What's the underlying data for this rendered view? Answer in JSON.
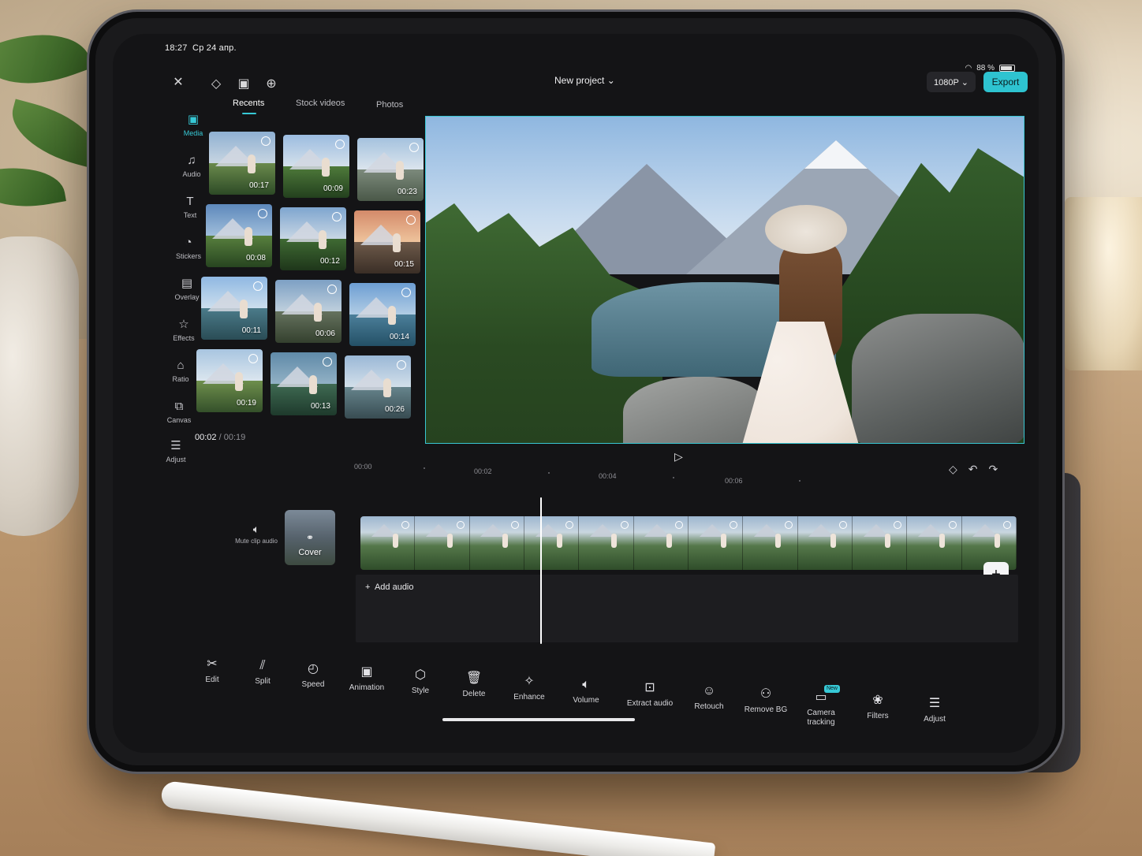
{
  "status": {
    "time": "18:27",
    "date": "Ср 24 апр.",
    "battery": "88 %"
  },
  "header": {
    "project_title": "New project ⌄",
    "resolution": "1080P ⌄",
    "export_label": "Export"
  },
  "sidebar": {
    "items": [
      {
        "label": "Media",
        "icon": "media-icon"
      },
      {
        "label": "Audio",
        "icon": "music-note-icon"
      },
      {
        "label": "Text",
        "icon": "text-icon"
      },
      {
        "label": "Stickers",
        "icon": "sticker-icon"
      },
      {
        "label": "Overlay",
        "icon": "overlay-icon"
      },
      {
        "label": "Effects",
        "icon": "effects-icon"
      },
      {
        "label": "Ratio",
        "icon": "ratio-icon"
      },
      {
        "label": "Canvas",
        "icon": "canvas-icon"
      },
      {
        "label": "Adjust",
        "icon": "adjust-icon"
      }
    ]
  },
  "media_tabs": [
    "Recents",
    "Stock videos",
    "Photos"
  ],
  "media_grid": [
    "00:17",
    "00:09",
    "00:23",
    "00:08",
    "00:12",
    "00:15",
    "00:11",
    "00:06",
    "00:14",
    "00:19",
    "00:13",
    "00:26"
  ],
  "timecode": {
    "current": "00:02",
    "total": "/ 00:19"
  },
  "ruler": [
    "00:00",
    "00:02",
    "00:04",
    "00:06"
  ],
  "timeline": {
    "mute_label": "Mute clip audio",
    "cover_label": "Cover",
    "add_audio_label": "Add audio"
  },
  "toolbar": [
    {
      "label": "Edit",
      "icon": "scissors-icon"
    },
    {
      "label": "Split",
      "icon": "split-icon"
    },
    {
      "label": "Speed",
      "icon": "speed-icon"
    },
    {
      "label": "Animation",
      "icon": "animation-icon"
    },
    {
      "label": "Style",
      "icon": "style-icon"
    },
    {
      "label": "Delete",
      "icon": "trash-icon"
    },
    {
      "label": "Enhance",
      "icon": "enhance-icon"
    },
    {
      "label": "Volume",
      "icon": "volume-icon"
    },
    {
      "label": "Extract audio",
      "icon": "extract-audio-icon"
    },
    {
      "label": "Retouch",
      "icon": "retouch-icon"
    },
    {
      "label": "Remove BG",
      "icon": "remove-bg-icon"
    },
    {
      "label": "Camera tracking",
      "icon": "camera-tracking-icon",
      "badge": "New"
    },
    {
      "label": "Filters",
      "icon": "filters-icon"
    },
    {
      "label": "Adjust",
      "icon": "adjust-icon"
    }
  ],
  "colors": {
    "accent": "#37c9d6",
    "export": "#2ec3d0",
    "background": "#141416"
  }
}
